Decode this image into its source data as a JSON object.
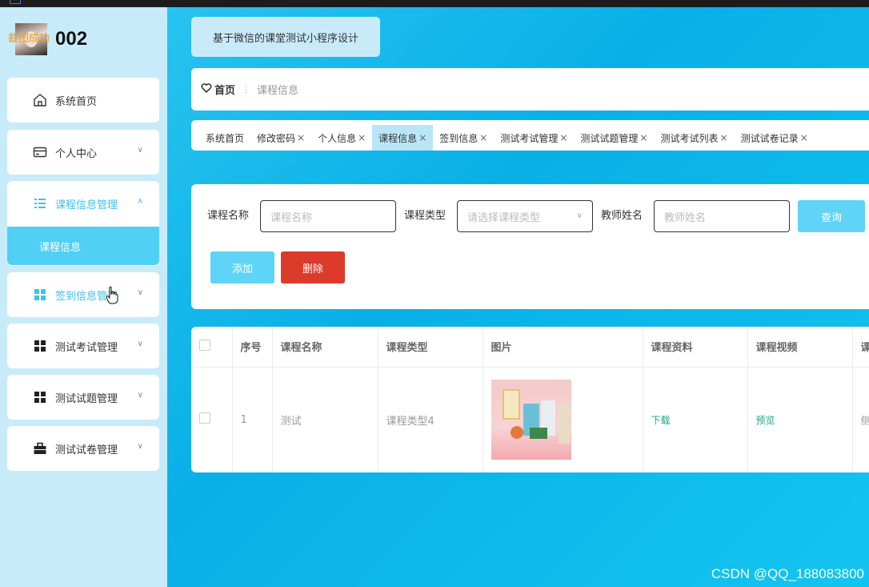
{
  "user": {
    "name": "002",
    "overlay": "截图成功"
  },
  "sidebar": {
    "items": [
      {
        "label": "系统首页",
        "icon": "home-icon",
        "expandable": false
      },
      {
        "label": "个人中心",
        "icon": "card-icon",
        "expandable": true
      },
      {
        "label": "课程信息管理",
        "icon": "list-icon",
        "expandable": true,
        "expanded": true,
        "children": [
          "课程信息"
        ]
      },
      {
        "label": "签到信息管理",
        "icon": "grid-icon",
        "expandable": true
      },
      {
        "label": "测试考试管理",
        "icon": "grid-icon",
        "expandable": true
      },
      {
        "label": "测试试题管理",
        "icon": "grid-icon",
        "expandable": true
      },
      {
        "label": "测试试卷管理",
        "icon": "briefcase-icon",
        "expandable": true
      }
    ]
  },
  "header": {
    "title": "基于微信的课堂测试小程序设计"
  },
  "breadcrumb": {
    "home": "首页",
    "separator": "⋮",
    "current": "课程信息"
  },
  "tabs": [
    {
      "label": "系统首页",
      "closable": false,
      "active": false
    },
    {
      "label": "修改密码",
      "closable": true,
      "active": false
    },
    {
      "label": "个人信息",
      "closable": true,
      "active": false
    },
    {
      "label": "课程信息",
      "closable": true,
      "active": true
    },
    {
      "label": "签到信息",
      "closable": true,
      "active": false
    },
    {
      "label": "测试考试管理",
      "closable": true,
      "active": false
    },
    {
      "label": "测试试题管理",
      "closable": true,
      "active": false
    },
    {
      "label": "测试考试列表",
      "closable": true,
      "active": false
    },
    {
      "label": "测试试卷记录",
      "closable": true,
      "active": false
    }
  ],
  "search": {
    "course_name_label": "课程名称",
    "course_name_placeholder": "课程名称",
    "course_type_label": "课程类型",
    "course_type_placeholder": "请选择课程类型",
    "teacher_label": "教师姓名",
    "teacher_placeholder": "教师姓名",
    "query_button": "查询",
    "add_button": "添加",
    "delete_button": "删除"
  },
  "table": {
    "columns": [
      "序号",
      "课程名称",
      "课程类型",
      "图片",
      "课程资料",
      "课程视频",
      "课"
    ],
    "rows": [
      {
        "index": "1",
        "name": "测试",
        "type": "课程类型4",
        "material": "下载",
        "video": "预览",
        "extra": "侧"
      }
    ]
  },
  "colors": {
    "accent": "#3ec1ec",
    "danger": "#dc3b2c",
    "link": "#19a97b",
    "sidebar_bg": "#c8ebf9"
  },
  "watermark": "CSDN @QQ_188083800"
}
